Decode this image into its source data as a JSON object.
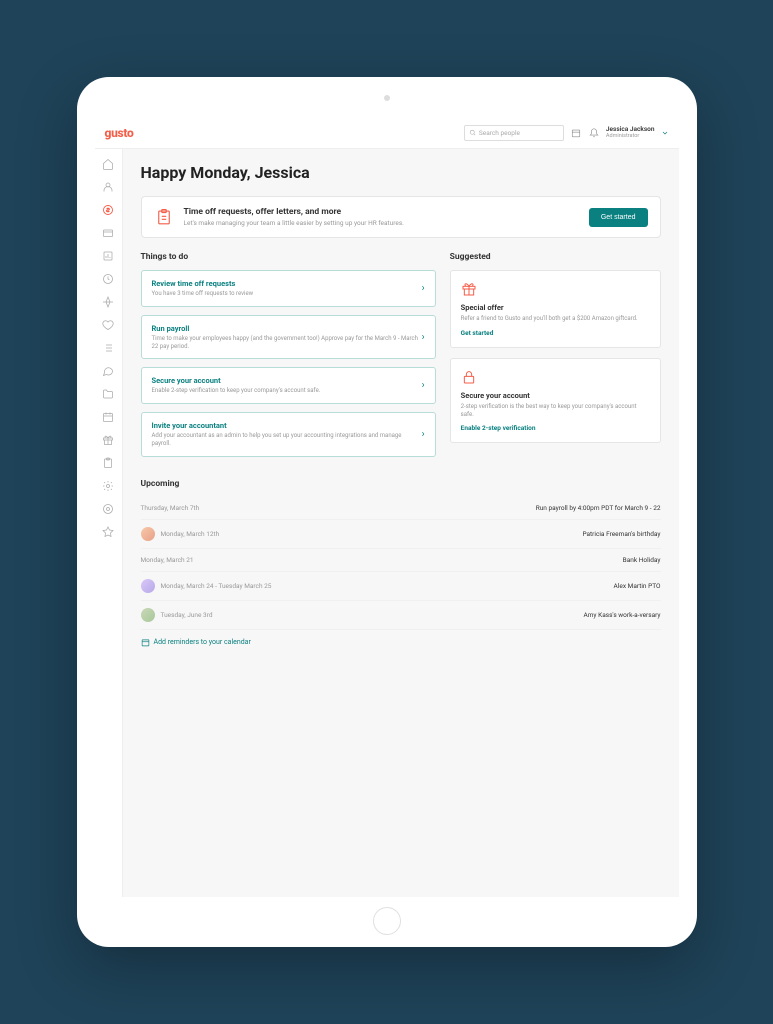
{
  "logo": "gusto",
  "search_placeholder": "Search people",
  "user": {
    "name": "Jessica Jackson",
    "role": "Administrator"
  },
  "greeting": "Happy Monday, Jessica",
  "banner": {
    "title": "Time off requests, offer letters, and more",
    "sub": "Let's make managing your team a little easier by setting up your HR features.",
    "cta": "Get started"
  },
  "todo_heading": "Things to do",
  "todos": [
    {
      "title": "Review time off requests",
      "sub": "You have 3 time off requests to review"
    },
    {
      "title": "Run payroll",
      "sub": "Time to make your employees happy (and the government too!) Approve pay for the March 9 - March 22 pay period."
    },
    {
      "title": "Secure your account",
      "sub": "Enable 2-step verification to keep your company's account safe."
    },
    {
      "title": "Invite your accountant",
      "sub": "Add your accountant as an admin to help you set up your accounting integrations and manage payroll."
    }
  ],
  "suggested_heading": "Suggested",
  "suggested": [
    {
      "title": "Special offer",
      "sub": "Refer a friend to Gusto and you'll both get a $200 Amazon giftcard.",
      "link": "Get started"
    },
    {
      "title": "Secure your account",
      "sub": "2-step verification is the best way to keep your company's account safe.",
      "link": "Enable 2-step verification"
    }
  ],
  "upcoming_heading": "Upcoming",
  "upcoming": [
    {
      "date": "Thursday, March 7th",
      "info": "Run payroll by 4:00pm PDT for March 9 - 22"
    },
    {
      "date": "Monday, March 12th",
      "info": "Patricia Freeman's birthday"
    },
    {
      "date": "Monday, March 21",
      "info": "Bank Holiday"
    },
    {
      "date": "Monday, March 24 - Tuesday March 25",
      "info": "Alex Martin PTO"
    },
    {
      "date": "Tuesday, June 3rd",
      "info": "Amy Kass's work-a-versary"
    }
  ],
  "add_reminder": "Add reminders to your calendar",
  "sidebar_items": [
    "home",
    "people",
    "payroll",
    "wallet",
    "reports",
    "time",
    "plane",
    "heart",
    "list",
    "chat",
    "folder",
    "calendar",
    "gift",
    "clipboard",
    "settings",
    "help",
    "star"
  ]
}
